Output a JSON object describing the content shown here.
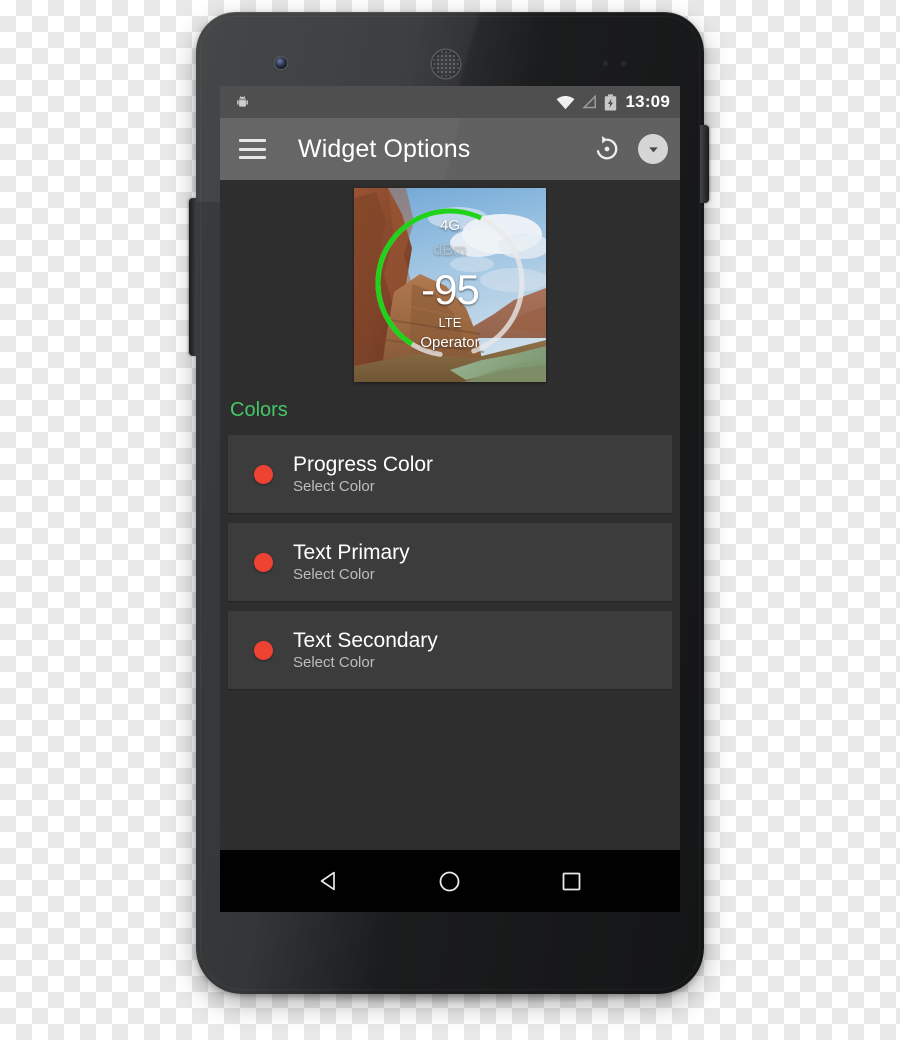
{
  "status_bar": {
    "android_icon": "android-robot-icon",
    "wifi_icon": "wifi-icon",
    "cell_signal_icon": "cell-signal-empty-icon",
    "battery_icon": "battery-charging-icon",
    "clock": "13:09"
  },
  "app_bar": {
    "menu_icon": "hamburger-menu-icon",
    "title": "Widget Options",
    "restore_icon": "restore-defaults-icon",
    "dropdown_icon": "chevron-down-icon"
  },
  "widget_preview": {
    "network": "4G",
    "unit": "dBm",
    "value": "-95",
    "technology": "LTE",
    "operator": "Operator",
    "progress_arc_color": "#21d21a",
    "track_arc_color": "#e9e9e9"
  },
  "section": {
    "title": "Colors",
    "title_color": "#44c767"
  },
  "color_rows": [
    {
      "title": "Progress Color",
      "subtitle": "Select Color",
      "swatch": "#ee4233"
    },
    {
      "title": "Text Primary",
      "subtitle": "Select Color",
      "swatch": "#ee4233"
    },
    {
      "title": "Text Secondary",
      "subtitle": "Select Color",
      "swatch": "#ee4233"
    }
  ],
  "nav_bar": {
    "back": "back-triangle-icon",
    "home": "home-circle-icon",
    "recents": "recents-square-icon"
  }
}
